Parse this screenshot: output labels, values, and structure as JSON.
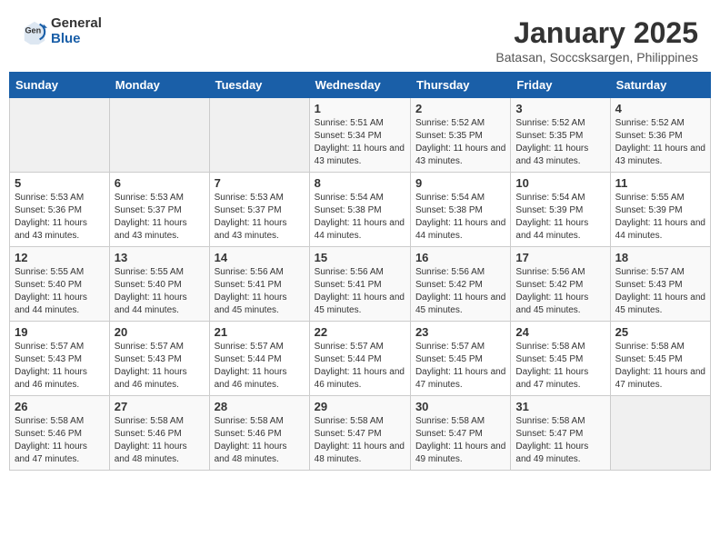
{
  "header": {
    "logo_general": "General",
    "logo_blue": "Blue",
    "month_title": "January 2025",
    "location": "Batasan, Soccsksargen, Philippines"
  },
  "weekdays": [
    "Sunday",
    "Monday",
    "Tuesday",
    "Wednesday",
    "Thursday",
    "Friday",
    "Saturday"
  ],
  "weeks": [
    [
      {
        "day": "",
        "sunrise": "",
        "sunset": "",
        "daylight": ""
      },
      {
        "day": "",
        "sunrise": "",
        "sunset": "",
        "daylight": ""
      },
      {
        "day": "",
        "sunrise": "",
        "sunset": "",
        "daylight": ""
      },
      {
        "day": "1",
        "sunrise": "Sunrise: 5:51 AM",
        "sunset": "Sunset: 5:34 PM",
        "daylight": "Daylight: 11 hours and 43 minutes."
      },
      {
        "day": "2",
        "sunrise": "Sunrise: 5:52 AM",
        "sunset": "Sunset: 5:35 PM",
        "daylight": "Daylight: 11 hours and 43 minutes."
      },
      {
        "day": "3",
        "sunrise": "Sunrise: 5:52 AM",
        "sunset": "Sunset: 5:35 PM",
        "daylight": "Daylight: 11 hours and 43 minutes."
      },
      {
        "day": "4",
        "sunrise": "Sunrise: 5:52 AM",
        "sunset": "Sunset: 5:36 PM",
        "daylight": "Daylight: 11 hours and 43 minutes."
      }
    ],
    [
      {
        "day": "5",
        "sunrise": "Sunrise: 5:53 AM",
        "sunset": "Sunset: 5:36 PM",
        "daylight": "Daylight: 11 hours and 43 minutes."
      },
      {
        "day": "6",
        "sunrise": "Sunrise: 5:53 AM",
        "sunset": "Sunset: 5:37 PM",
        "daylight": "Daylight: 11 hours and 43 minutes."
      },
      {
        "day": "7",
        "sunrise": "Sunrise: 5:53 AM",
        "sunset": "Sunset: 5:37 PM",
        "daylight": "Daylight: 11 hours and 43 minutes."
      },
      {
        "day": "8",
        "sunrise": "Sunrise: 5:54 AM",
        "sunset": "Sunset: 5:38 PM",
        "daylight": "Daylight: 11 hours and 44 minutes."
      },
      {
        "day": "9",
        "sunrise": "Sunrise: 5:54 AM",
        "sunset": "Sunset: 5:38 PM",
        "daylight": "Daylight: 11 hours and 44 minutes."
      },
      {
        "day": "10",
        "sunrise": "Sunrise: 5:54 AM",
        "sunset": "Sunset: 5:39 PM",
        "daylight": "Daylight: 11 hours and 44 minutes."
      },
      {
        "day": "11",
        "sunrise": "Sunrise: 5:55 AM",
        "sunset": "Sunset: 5:39 PM",
        "daylight": "Daylight: 11 hours and 44 minutes."
      }
    ],
    [
      {
        "day": "12",
        "sunrise": "Sunrise: 5:55 AM",
        "sunset": "Sunset: 5:40 PM",
        "daylight": "Daylight: 11 hours and 44 minutes."
      },
      {
        "day": "13",
        "sunrise": "Sunrise: 5:55 AM",
        "sunset": "Sunset: 5:40 PM",
        "daylight": "Daylight: 11 hours and 44 minutes."
      },
      {
        "day": "14",
        "sunrise": "Sunrise: 5:56 AM",
        "sunset": "Sunset: 5:41 PM",
        "daylight": "Daylight: 11 hours and 45 minutes."
      },
      {
        "day": "15",
        "sunrise": "Sunrise: 5:56 AM",
        "sunset": "Sunset: 5:41 PM",
        "daylight": "Daylight: 11 hours and 45 minutes."
      },
      {
        "day": "16",
        "sunrise": "Sunrise: 5:56 AM",
        "sunset": "Sunset: 5:42 PM",
        "daylight": "Daylight: 11 hours and 45 minutes."
      },
      {
        "day": "17",
        "sunrise": "Sunrise: 5:56 AM",
        "sunset": "Sunset: 5:42 PM",
        "daylight": "Daylight: 11 hours and 45 minutes."
      },
      {
        "day": "18",
        "sunrise": "Sunrise: 5:57 AM",
        "sunset": "Sunset: 5:43 PM",
        "daylight": "Daylight: 11 hours and 45 minutes."
      }
    ],
    [
      {
        "day": "19",
        "sunrise": "Sunrise: 5:57 AM",
        "sunset": "Sunset: 5:43 PM",
        "daylight": "Daylight: 11 hours and 46 minutes."
      },
      {
        "day": "20",
        "sunrise": "Sunrise: 5:57 AM",
        "sunset": "Sunset: 5:43 PM",
        "daylight": "Daylight: 11 hours and 46 minutes."
      },
      {
        "day": "21",
        "sunrise": "Sunrise: 5:57 AM",
        "sunset": "Sunset: 5:44 PM",
        "daylight": "Daylight: 11 hours and 46 minutes."
      },
      {
        "day": "22",
        "sunrise": "Sunrise: 5:57 AM",
        "sunset": "Sunset: 5:44 PM",
        "daylight": "Daylight: 11 hours and 46 minutes."
      },
      {
        "day": "23",
        "sunrise": "Sunrise: 5:57 AM",
        "sunset": "Sunset: 5:45 PM",
        "daylight": "Daylight: 11 hours and 47 minutes."
      },
      {
        "day": "24",
        "sunrise": "Sunrise: 5:58 AM",
        "sunset": "Sunset: 5:45 PM",
        "daylight": "Daylight: 11 hours and 47 minutes."
      },
      {
        "day": "25",
        "sunrise": "Sunrise: 5:58 AM",
        "sunset": "Sunset: 5:45 PM",
        "daylight": "Daylight: 11 hours and 47 minutes."
      }
    ],
    [
      {
        "day": "26",
        "sunrise": "Sunrise: 5:58 AM",
        "sunset": "Sunset: 5:46 PM",
        "daylight": "Daylight: 11 hours and 47 minutes."
      },
      {
        "day": "27",
        "sunrise": "Sunrise: 5:58 AM",
        "sunset": "Sunset: 5:46 PM",
        "daylight": "Daylight: 11 hours and 48 minutes."
      },
      {
        "day": "28",
        "sunrise": "Sunrise: 5:58 AM",
        "sunset": "Sunset: 5:46 PM",
        "daylight": "Daylight: 11 hours and 48 minutes."
      },
      {
        "day": "29",
        "sunrise": "Sunrise: 5:58 AM",
        "sunset": "Sunset: 5:47 PM",
        "daylight": "Daylight: 11 hours and 48 minutes."
      },
      {
        "day": "30",
        "sunrise": "Sunrise: 5:58 AM",
        "sunset": "Sunset: 5:47 PM",
        "daylight": "Daylight: 11 hours and 49 minutes."
      },
      {
        "day": "31",
        "sunrise": "Sunrise: 5:58 AM",
        "sunset": "Sunset: 5:47 PM",
        "daylight": "Daylight: 11 hours and 49 minutes."
      },
      {
        "day": "",
        "sunrise": "",
        "sunset": "",
        "daylight": ""
      }
    ]
  ]
}
